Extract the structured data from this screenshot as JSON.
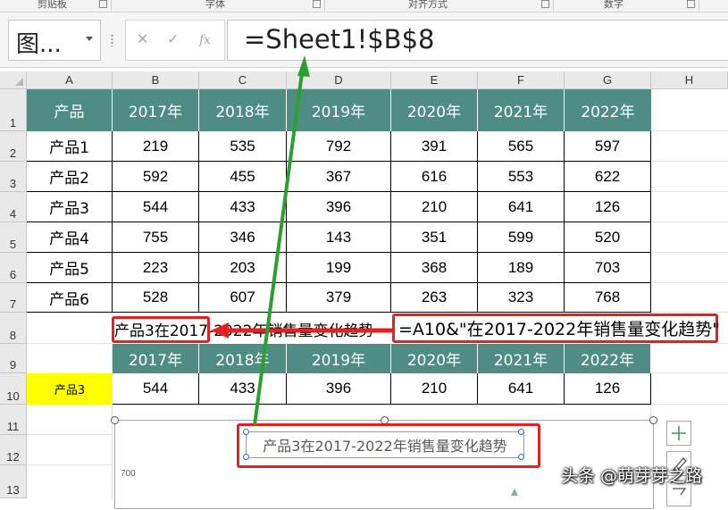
{
  "ribbon": {
    "groups": [
      "剪贴板",
      "字体",
      "对齐方式",
      "数字"
    ]
  },
  "formula_bar": {
    "name_box": "图...",
    "cancel_icon": "✕",
    "enter_icon": "✓",
    "fx_label": "fx",
    "formula": "=Sheet1!$B$8"
  },
  "columns": [
    "A",
    "B",
    "C",
    "D",
    "E",
    "F",
    "G",
    "H"
  ],
  "rows": [
    "1",
    "2",
    "3",
    "4",
    "5",
    "6",
    "7",
    "8",
    "9",
    "10",
    "11",
    "12",
    "13"
  ],
  "table": {
    "header": [
      "产品",
      "2017年",
      "2018年",
      "2019年",
      "2020年",
      "2021年",
      "2022年"
    ],
    "rows": [
      [
        "产品1",
        "219",
        "535",
        "792",
        "391",
        "565",
        "597"
      ],
      [
        "产品2",
        "592",
        "455",
        "367",
        "616",
        "553",
        "622"
      ],
      [
        "产品3",
        "544",
        "433",
        "396",
        "210",
        "641",
        "126"
      ],
      [
        "产品4",
        "755",
        "346",
        "143",
        "351",
        "599",
        "520"
      ],
      [
        "产品5",
        "223",
        "203",
        "199",
        "368",
        "189",
        "703"
      ],
      [
        "产品6",
        "528",
        "607",
        "379",
        "263",
        "323",
        "768"
      ]
    ]
  },
  "title_cell": "产品3在2017-2022年销售量变化趋势",
  "title_formula": "=A10&\"在2017-2022年销售量变化趋势\"",
  "mini_table": {
    "header": [
      "2017年",
      "2018年",
      "2019年",
      "2020年",
      "2021年",
      "2022年"
    ],
    "label": "产品3",
    "values": [
      "544",
      "433",
      "396",
      "210",
      "641",
      "126"
    ]
  },
  "chart": {
    "title": "产品3在2017-2022年销售量变化趋势",
    "ytick_top": "700"
  },
  "watermark": "头条 @萌芽芽之路",
  "colors": {
    "header_fill": "#4f8c83",
    "highlight": "#ffff00",
    "annotation_red": "#e32121",
    "arrow_green": "#2ca02c"
  },
  "icons": {
    "add_element": "plus-icon",
    "chart_style": "brush-icon",
    "chart_filter": "filter-icon"
  }
}
